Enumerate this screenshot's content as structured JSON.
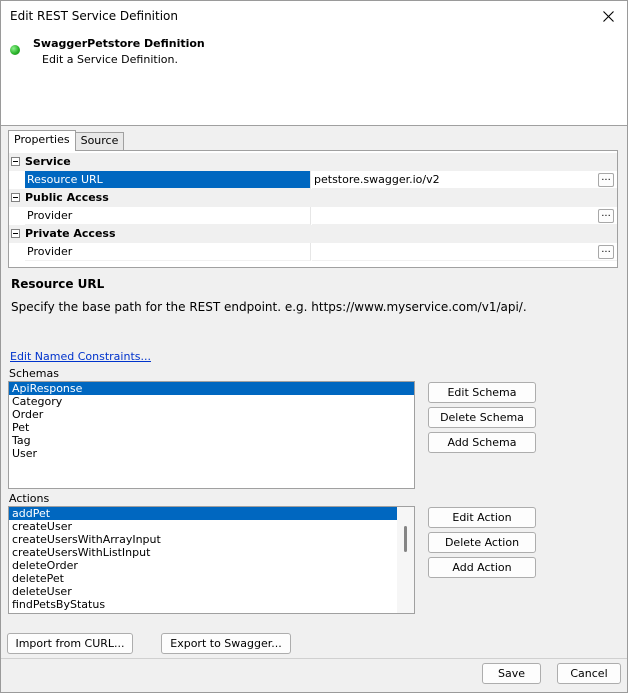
{
  "window": {
    "title": "Edit REST Service Definition",
    "close_icon": "close-icon"
  },
  "header": {
    "status_color": "#2cb52c",
    "title": "SwaggerPetstore Definition",
    "subtitle": "Edit a Service Definition."
  },
  "tabs": [
    {
      "label": "Properties",
      "active": true
    },
    {
      "label": "Source",
      "active": false
    }
  ],
  "property_grid": {
    "categories": [
      {
        "label": "Service",
        "rows": [
          {
            "name": "Resource URL",
            "value": "petstore.swagger.io/v2",
            "selected": true
          }
        ]
      },
      {
        "label": "Public Access",
        "rows": [
          {
            "name": "Provider",
            "value": ""
          }
        ]
      },
      {
        "label": "Private Access",
        "rows": [
          {
            "name": "Provider",
            "value": ""
          }
        ]
      }
    ],
    "ellipsis_label": "..."
  },
  "description": {
    "title": "Resource URL",
    "text": "Specify the base path for the REST endpoint. e.g. https://www.myservice.com/v1/api/."
  },
  "constraints_link": "Edit Named Constraints...",
  "schemas": {
    "label": "Schemas",
    "items": [
      "ApiResponse",
      "Category",
      "Order",
      "Pet",
      "Tag",
      "User"
    ],
    "selected": "ApiResponse",
    "buttons": {
      "edit": "Edit Schema",
      "delete": "Delete Schema",
      "add": "Add Schema"
    }
  },
  "actions": {
    "label": "Actions",
    "items": [
      "addPet",
      "createUser",
      "createUsersWithArrayInput",
      "createUsersWithListInput",
      "deleteOrder",
      "deletePet",
      "deleteUser",
      "findPetsByStatus"
    ],
    "selected": "addPet",
    "buttons": {
      "edit": "Edit Action",
      "delete": "Delete Action",
      "add": "Add Action"
    }
  },
  "bottom_buttons": {
    "import": "Import from CURL...",
    "export": "Export to Swagger..."
  },
  "footer": {
    "save": "Save",
    "cancel": "Cancel"
  },
  "colors": {
    "selection": "#0067c0",
    "link": "#0033cc"
  }
}
